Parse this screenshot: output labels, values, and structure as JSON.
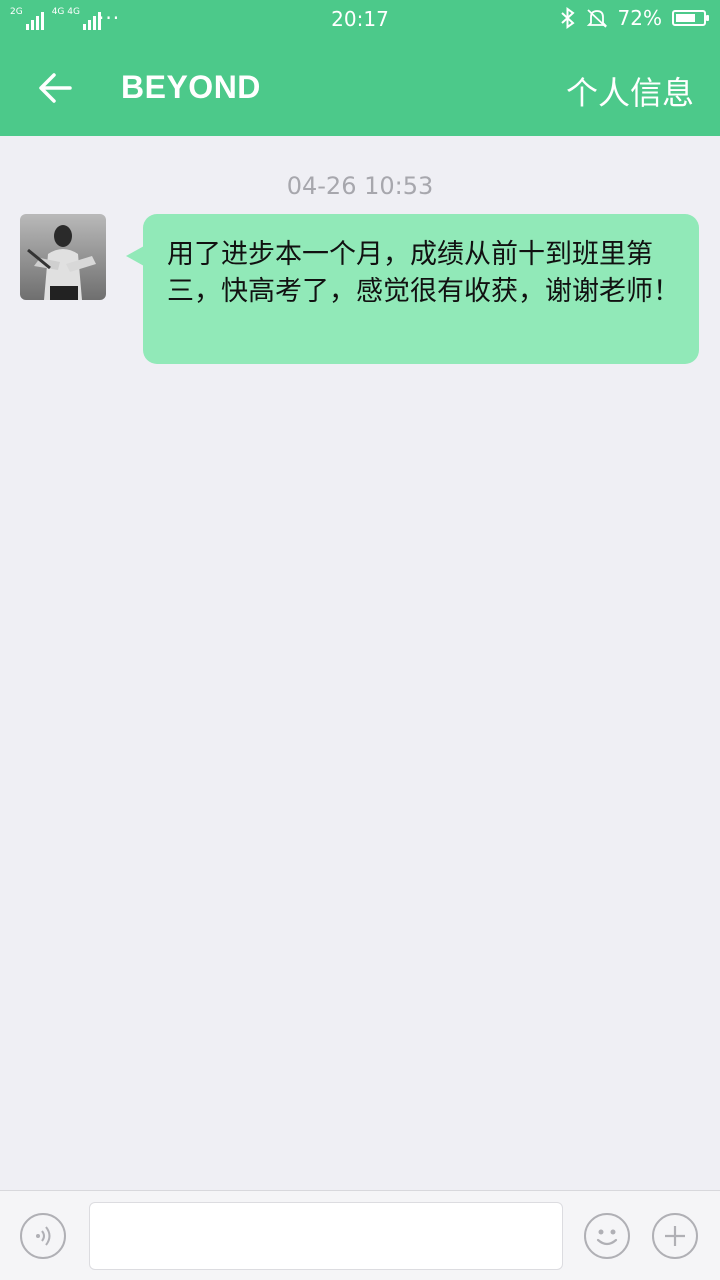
{
  "status_bar": {
    "network_1": "2G",
    "network_2": "4G 4G",
    "dots": "···",
    "time": "20:17",
    "bluetooth_icon": "bluetooth-icon",
    "mute_icon": "bell-off-icon",
    "battery_percent": "72%",
    "battery_level": 0.72
  },
  "header": {
    "back_icon": "arrow-left-icon",
    "title": "BEYOND",
    "profile_link": "个人信息"
  },
  "chat": {
    "timestamp": "04-26 10:53",
    "messages": [
      {
        "sender_avatar": "avatar",
        "text": "用了进步本一个月，成绩从前十到班里第三，快高考了，感觉很有收获，谢谢老师！"
      }
    ]
  },
  "input_bar": {
    "voice_icon": "voice-icon",
    "input_value": "",
    "emoji_icon": "emoji-icon",
    "plus_icon": "plus-icon"
  },
  "colors": {
    "header_bg": "#4cc98a",
    "bubble_bg": "#91e9b8",
    "page_bg": "#efeff4"
  }
}
